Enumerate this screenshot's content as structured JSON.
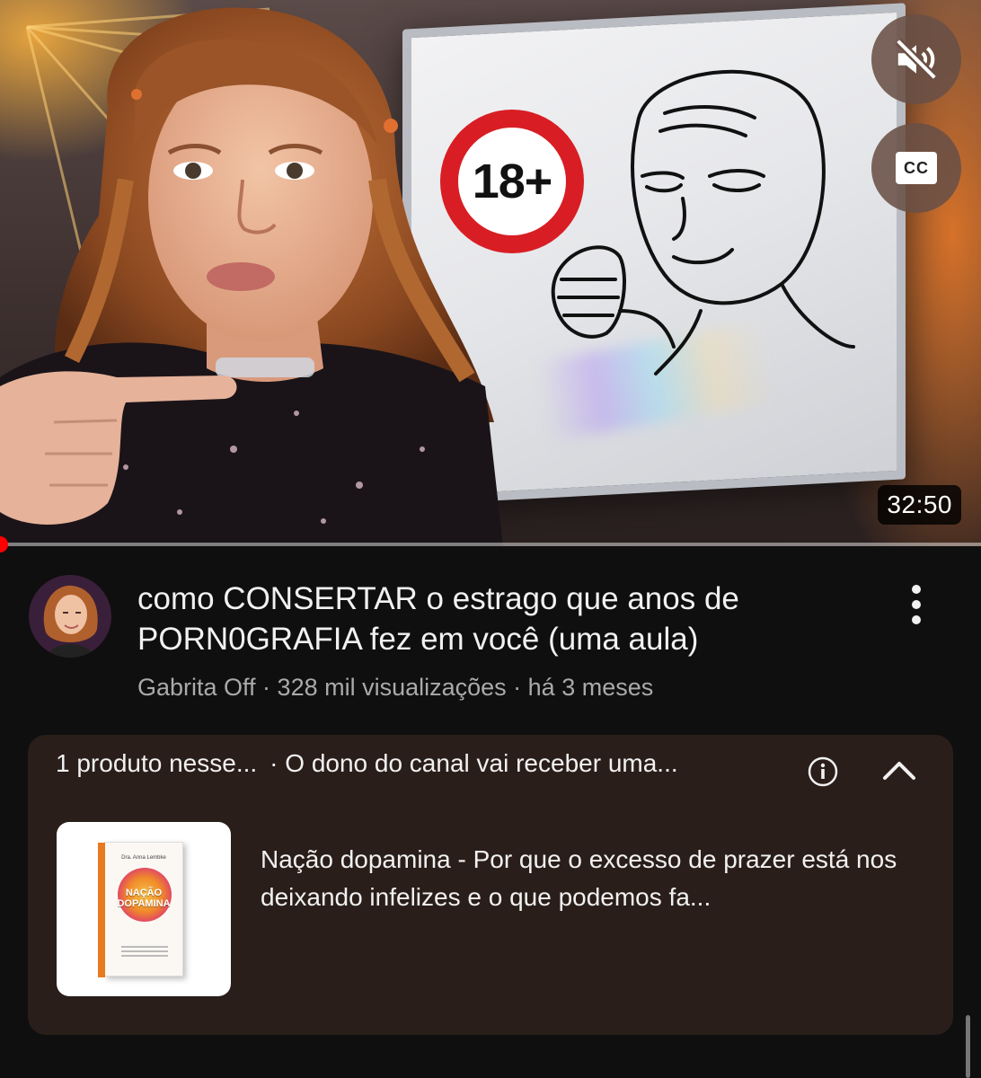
{
  "video": {
    "thumbnail_sign_text": "18+",
    "duration": "32:50",
    "progress": 0.0,
    "buttons": {
      "mute_icon": "volume-muted-icon",
      "cc_label": "CC"
    }
  },
  "info": {
    "title": "como CONSERTAR o estrago que anos de PORN0GRAFIA fez em você (uma aula)",
    "meta": "Gabrita Off · 328 mil visualizações · há 3 meses",
    "more_icon": "more-vert-icon"
  },
  "product_panel": {
    "header_count": "1 produto nesse...",
    "header_note": "· O dono do canal vai receber uma...",
    "info_icon": "info-icon",
    "collapse_icon": "chevron-up-icon",
    "product": {
      "book_author": "Dra. Anna Lembke",
      "book_title_line1": "NAÇÃO",
      "book_title_line2": "DOPAMINA",
      "description": "Nação dopamina - Por que o excesso de prazer está nos deixando infelizes e o que podemos fa..."
    }
  },
  "colors": {
    "background": "#0f0f0f",
    "card": "#2a1e1a",
    "accent_red": "#ff0000",
    "secondary_text": "#aaaaaa"
  }
}
